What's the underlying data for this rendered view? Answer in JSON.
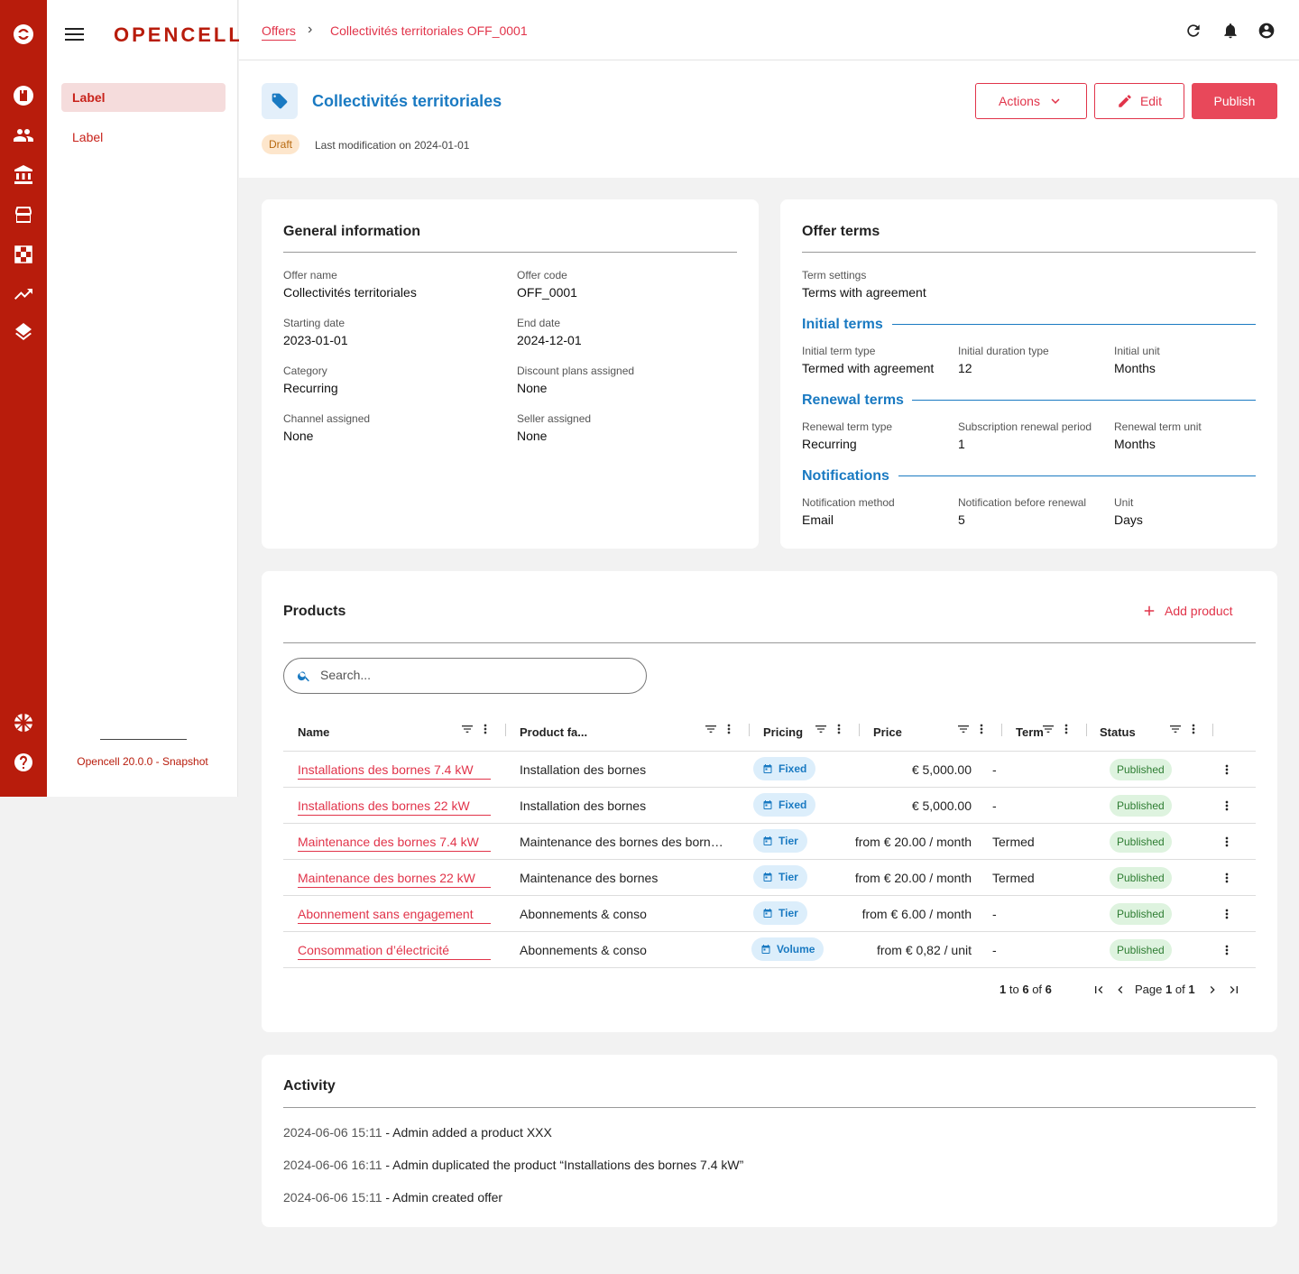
{
  "app": {
    "logo": "OPENCELL",
    "version": "Opencell 20.0.0 - Snapshot"
  },
  "rail": {
    "icons": [
      "opencell-logo-icon",
      "catalog-icon",
      "customers-icon",
      "finance-icon",
      "store-icon",
      "checkerboard-icon",
      "trending-icon",
      "layers-icon",
      "flag-uk-icon",
      "help-icon"
    ]
  },
  "sidenav": {
    "items": [
      {
        "label": "Label",
        "active": true
      },
      {
        "label": "Label",
        "active": false
      }
    ]
  },
  "breadcrumb": {
    "root": "Offers",
    "separator": "›",
    "current": "Collectivités territoriales OFF_0001"
  },
  "topbar_icons": [
    "refresh-icon",
    "bell-icon",
    "account-icon"
  ],
  "header": {
    "title": "Collectivités territoriales",
    "status": "Draft",
    "last_modification": "Last modification on 2024-01-01",
    "actions_label": "Actions",
    "edit_label": "Edit",
    "publish_label": "Publish"
  },
  "general": {
    "title": "General information",
    "fields": [
      {
        "label": "Offer name",
        "value": "Collectivités territoriales"
      },
      {
        "label": "Offer code",
        "value": "OFF_0001"
      },
      {
        "label": "Starting date",
        "value": "2023-01-01"
      },
      {
        "label": "End date",
        "value": "2024-12-01"
      },
      {
        "label": "Category",
        "value": "Recurring"
      },
      {
        "label": "Discount plans assigned",
        "value": "None"
      },
      {
        "label": "Channel assigned",
        "value": "None"
      },
      {
        "label": "Seller assigned",
        "value": "None"
      }
    ]
  },
  "terms": {
    "title": "Offer terms",
    "term_settings": {
      "label": "Term settings",
      "value": "Terms with agreement"
    },
    "initial": {
      "title": "Initial terms",
      "fields": [
        {
          "label": "Initial term type",
          "value": "Termed with agreement"
        },
        {
          "label": "Initial duration type",
          "value": "12"
        },
        {
          "label": "Initial unit",
          "value": "Months"
        }
      ]
    },
    "renewal": {
      "title": "Renewal terms",
      "fields": [
        {
          "label": "Renewal term type",
          "value": "Recurring"
        },
        {
          "label": "Subscription renewal period",
          "value": "1"
        },
        {
          "label": "Renewal term unit",
          "value": "Months"
        }
      ]
    },
    "notifications": {
      "title": "Notifications",
      "fields": [
        {
          "label": "Notification method",
          "value": "Email"
        },
        {
          "label": "Notification before renewal",
          "value": "5"
        },
        {
          "label": "Unit",
          "value": "Days"
        }
      ]
    }
  },
  "products": {
    "title": "Products",
    "add_label": "Add product",
    "search_placeholder": "Search...",
    "columns": [
      "Name",
      "Product fa...",
      "Pricing",
      "Price",
      "Term",
      "Status"
    ],
    "rows": [
      {
        "name": "Installations des bornes 7.4 kW",
        "family": "Installation des bornes",
        "pricing": "Fixed",
        "price": "€ 5,000.00",
        "term": "-",
        "status": "Published"
      },
      {
        "name": "Installations des bornes 22 kW",
        "family": "Installation des bornes",
        "pricing": "Fixed",
        "price": "€ 5,000.00",
        "term": "-",
        "status": "Published"
      },
      {
        "name": "Maintenance des bornes 7.4 kW",
        "family": "Maintenance des bornes des born…",
        "pricing": "Tier",
        "price": "from € 20.00 / month",
        "term": "Termed",
        "status": "Published"
      },
      {
        "name": "Maintenance des bornes 22 kW",
        "family": "Maintenance des bornes",
        "pricing": "Tier",
        "price": "from € 20.00 / month",
        "term": "Termed",
        "status": "Published"
      },
      {
        "name": "Abonnement sans engagement",
        "family": "Abonnements & conso",
        "pricing": "Tier",
        "price": "from € 6.00 / month",
        "term": "-",
        "status": "Published"
      },
      {
        "name": "Consommation d’électricité",
        "family": "Abonnements & conso",
        "pricing": "Volume",
        "price": "from € 0,82 / unit",
        "term": "-",
        "status": "Published"
      }
    ],
    "pagination": {
      "from": "1",
      "to_word": "to",
      "to": "6",
      "of_word": "of",
      "total": "6",
      "page_word": "Page",
      "page": "1",
      "pages": "1"
    }
  },
  "activity": {
    "title": "Activity",
    "entries": [
      {
        "time": "2024-06-06 15:11",
        "text": " - Admin added a product XXX"
      },
      {
        "time": "2024-06-06 16:11",
        "text": " - Admin duplicated the product “Installations des bornes 7.4 kW”"
      },
      {
        "time": "2024-06-06 15:11",
        "text": " - Admin created offer"
      }
    ]
  },
  "colors": {
    "brand_red": "#b81c0c",
    "accent_pink": "#e1344a",
    "blue": "#1a7ac2",
    "published_green": "#2e7d32",
    "draft_orange": "#b8690f"
  }
}
